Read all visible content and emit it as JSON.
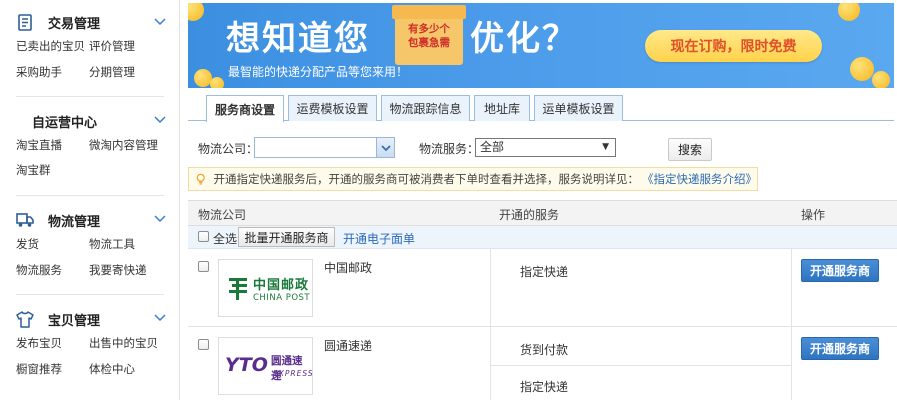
{
  "sidebar": {
    "sections": [
      {
        "title": "交易管理",
        "icon": "document-icon",
        "links": [
          "已卖出的宝贝",
          "评价管理",
          "采购助手",
          "分期管理"
        ]
      },
      {
        "title": "自运营中心",
        "icon": "",
        "links": [
          "淘宝直播",
          "微淘内容管理",
          "淘宝群"
        ]
      },
      {
        "title": "物流管理",
        "icon": "truck-icon",
        "links": [
          "发货",
          "物流工具",
          "物流服务",
          "我要寄快递"
        ]
      },
      {
        "title": "宝贝管理",
        "icon": "shirt-icon",
        "links": [
          "发布宝贝",
          "出售中的宝贝",
          "橱窗推荐",
          "体检中心"
        ]
      }
    ]
  },
  "banner": {
    "title_left": "想知道您",
    "box_text_1": "有多少个",
    "box_text_2": "包裹急需",
    "title_right": "优化？",
    "subtitle": "最智能的快递分配产品等您来用！",
    "cta": "现在订购，限时免费"
  },
  "tabs": [
    "服务商设置",
    "运费模板设置",
    "物流跟踪信息",
    "地址库",
    "运单模板设置"
  ],
  "search": {
    "company_label": "物流公司：",
    "company_value": "",
    "service_label": "物流服务：",
    "service_value": "全部",
    "search_button": "搜索"
  },
  "tip": {
    "text": "开通指定快递服务后，开通的服务商可被消费者下单时查看并选择，服务说明详见：",
    "link": "《指定快递服务介绍》"
  },
  "table": {
    "headers": [
      "物流公司",
      "开通的服务",
      "操作"
    ],
    "select_all": "全选",
    "batch_button": "批量开通服务商",
    "ewaybill_link": "开通电子面单",
    "rows": [
      {
        "name": "中国邮政",
        "logo_cn": "中国邮政",
        "logo_en": "CHINA POST",
        "services": [
          "指定快递"
        ],
        "action": "开通服务商"
      },
      {
        "name": "圆通速递",
        "logo_cn": "圆通速递",
        "logo_en": "EXPRESS",
        "logo_mark": "YTO",
        "services": [
          "货到付款",
          "指定快递"
        ],
        "action": "开通服务商"
      }
    ]
  },
  "colors": {
    "banner_blue": "#4d9deb",
    "tab_border": "#9bbde0",
    "link_blue": "#2a6ab8",
    "button_blue": "#2e74c0",
    "post_green": "#1a7a3a",
    "yto_purple": "#5a2d8c"
  }
}
